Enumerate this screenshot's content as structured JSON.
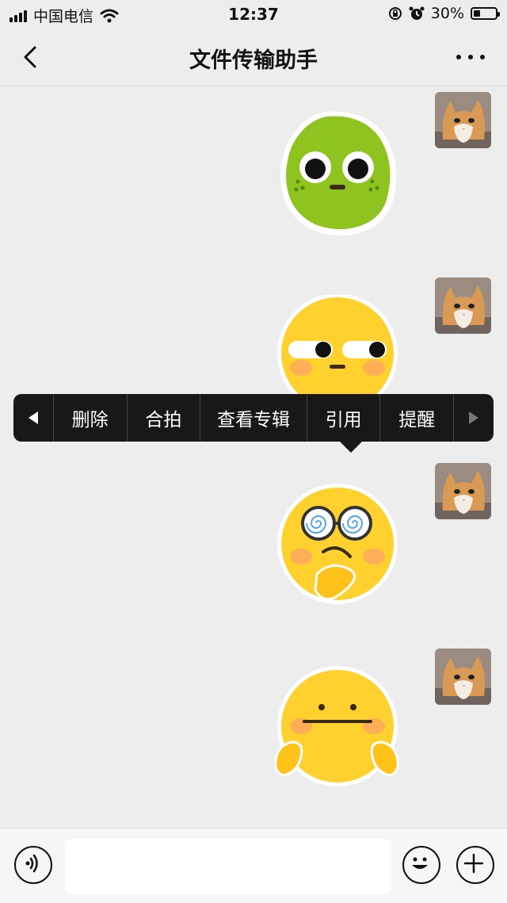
{
  "status_bar": {
    "carrier": "中国电信",
    "time": "12:37",
    "battery_percent": "30%",
    "battery_level": 0.3,
    "icons": [
      "signal-icon",
      "wifi-icon",
      "rotation-lock-icon",
      "alarm-icon",
      "battery-icon"
    ]
  },
  "nav": {
    "title": "文件传输助手",
    "back_icon": "chevron-left-icon",
    "more_icon": "more-dots-icon"
  },
  "messages": [
    {
      "type": "sticker",
      "sticker": "green-lime-face"
    },
    {
      "type": "sticker",
      "sticker": "side-eye-face"
    },
    {
      "type": "sticker",
      "sticker": "dizzy-thinking-face"
    },
    {
      "type": "sticker",
      "sticker": "shrug-face"
    }
  ],
  "context_menu": {
    "items": [
      "删除",
      "合拍",
      "查看专辑",
      "引用",
      "提醒"
    ],
    "prev_icon": "triangle-left-icon",
    "next_icon": "triangle-right-icon"
  },
  "input_bar": {
    "voice_icon": "voice-icon",
    "emoji_icon": "emoji-icon",
    "plus_icon": "plus-icon",
    "text_value": ""
  },
  "colors": {
    "background": "#ededed",
    "menu_background": "#181818",
    "green_sticker": "#8fc31f",
    "yellow_sticker": "#ffd12e"
  }
}
